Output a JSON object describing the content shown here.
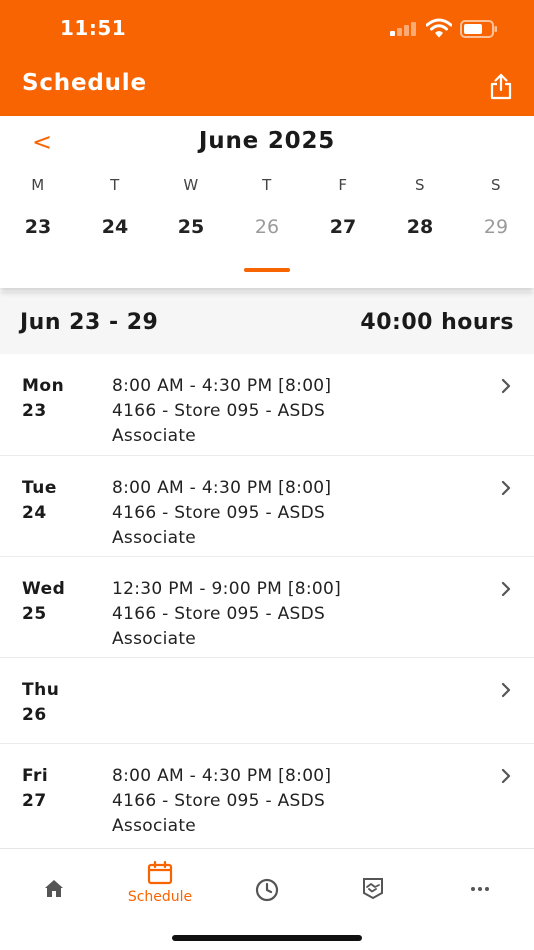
{
  "status_bar": {
    "time": "11:51"
  },
  "header": {
    "title": "Schedule",
    "share_icon": "share-icon"
  },
  "calendar": {
    "month_title": "June 2025",
    "prev_icon": "chevron-left-icon",
    "prev_glyph": "<",
    "weekdays": [
      "M",
      "T",
      "W",
      "T",
      "F",
      "S",
      "S"
    ],
    "dates": [
      "23",
      "24",
      "25",
      "26",
      "27",
      "28",
      "29"
    ],
    "selected_index": 3
  },
  "week_summary": {
    "range": "Jun 23 - 29",
    "hours": "40:00 hours"
  },
  "days": [
    {
      "day": "Mon",
      "date": "23",
      "lines": [
        "8:00 AM - 4:30 PM [8:00]",
        "4166 - Store 095 - ASDS",
        "Associate"
      ]
    },
    {
      "day": "Tue",
      "date": "24",
      "lines": [
        "8:00 AM - 4:30 PM [8:00]",
        "4166 - Store 095 - ASDS",
        "Associate"
      ]
    },
    {
      "day": "Wed",
      "date": "25",
      "lines": [
        "12:30 PM - 9:00 PM [8:00]",
        "4166 - Store 095 - ASDS",
        "Associate"
      ]
    },
    {
      "day": "Thu",
      "date": "26",
      "lines": []
    },
    {
      "day": "Fri",
      "date": "27",
      "lines": [
        "8:00 AM - 4:30 PM [8:00]",
        "4166 - Store 095 - ASDS",
        "Associate"
      ]
    }
  ],
  "tab_bar": {
    "tabs": [
      {
        "icon": "home-icon",
        "label": ""
      },
      {
        "icon": "calendar-icon",
        "label": "Schedule",
        "active": true
      },
      {
        "icon": "clock-icon",
        "label": ""
      },
      {
        "icon": "handshake-icon",
        "label": ""
      },
      {
        "icon": "more-icon",
        "label": ""
      }
    ]
  },
  "colors": {
    "brand": "#F96402",
    "muted": "#9a9a9a"
  }
}
